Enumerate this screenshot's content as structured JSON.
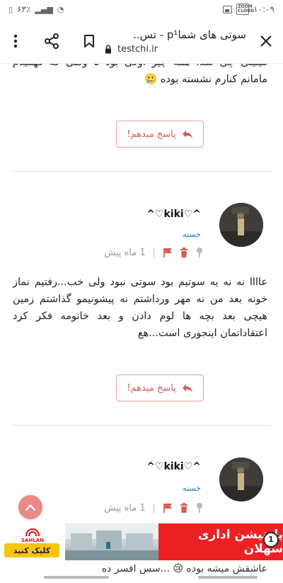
{
  "status_bar": {
    "time": "۱۰:۰۹",
    "battery": "۶۳٪",
    "zoom_badge": "ZOOM CLOUD"
  },
  "toolbar": {
    "title": "سوتی های شماp¹ - تس..",
    "url": "testchi.ir"
  },
  "comments": [
    {
      "text_fragment": "میتیلی چی شد: همه چیز اوکی بود تا وقتی که فهمیدم مامانم کنارم نشسته بوده 🥲",
      "reply_label": "پاسخ میدهم!"
    },
    {
      "username": "^♡kiki♡^",
      "role": "خسته",
      "time": "1 ماه پیش",
      "meta_sep": "|",
      "text": "عاااا نه نه یه سوتیم بود سوتی نبود ولی خب...رفتیم نماز خونه بعد من نه مهر ورداشتم نه پیشونیمو گذاشتم زمین هیچی بعد بچه ها لوم دادن و بعد خانومه فکر کرد اعتقاداتمان اینجوری است...هع",
      "reply_label": "پاسخ میدهم!"
    },
    {
      "username": "^♡kiki♡^",
      "role": "خسته",
      "time": "1 ماه پیش",
      "meta_sep": "|",
      "text_fragment": "عاشقش میشه بوده 😢 ...سس افسر ده"
    }
  ],
  "ad": {
    "headline": "پارتیشن اداری سهلان",
    "brand": "SAHLAN",
    "cta": "کلیک کنید",
    "seal_text": "1"
  },
  "colors": {
    "accent": "#d65c55",
    "role": "#1b7aa8",
    "ad_red": "#ed2024",
    "ad_yellow": "#f8c515"
  }
}
